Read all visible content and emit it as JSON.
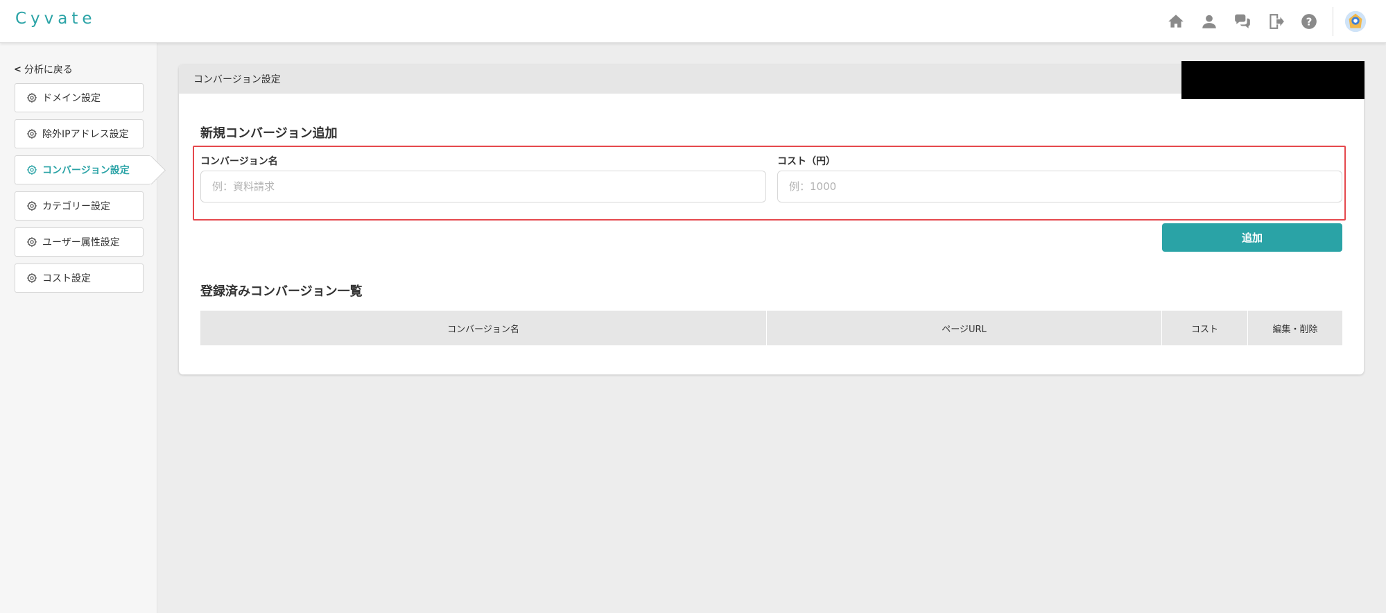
{
  "app": {
    "logo": "Cyvate"
  },
  "header": {
    "icons": [
      "home-icon",
      "user-icon",
      "chat-icon",
      "logout-icon",
      "help-icon",
      "avatar-icon"
    ]
  },
  "sidebar": {
    "back_label": "分析に戻る",
    "items": [
      {
        "label": "ドメイン設定",
        "icon": "gear-icon",
        "active": false
      },
      {
        "label": "除外IPアドレス設定",
        "icon": "gear-icon",
        "active": false
      },
      {
        "label": "コンバージョン設定",
        "icon": "gear-icon",
        "active": true
      },
      {
        "label": "カテゴリー設定",
        "icon": "gear-icon",
        "active": false
      },
      {
        "label": "ユーザー属性設定",
        "icon": "gear-icon",
        "active": false
      },
      {
        "label": "コスト設定",
        "icon": "gear-icon",
        "active": false
      }
    ]
  },
  "main": {
    "card_title": "コンバージョン設定",
    "new_section_title": "新規コンバージョン追加",
    "fields": {
      "name_label": "コンバージョン名",
      "name_placeholder": "例：資料請求",
      "name_value": "",
      "cost_label": "コスト（円）",
      "cost_placeholder": "例：1000",
      "cost_value": ""
    },
    "add_button": "追加",
    "list_section_title": "登録済みコンバージョン一覧",
    "table": {
      "columns": [
        "コンバージョン名",
        "ページURL",
        "コスト",
        "編集・削除"
      ],
      "rows": []
    }
  },
  "colors": {
    "accent": "#2aa3a6",
    "highlight_border": "#e5484d",
    "table_header_bg": "#e6e6e6"
  }
}
